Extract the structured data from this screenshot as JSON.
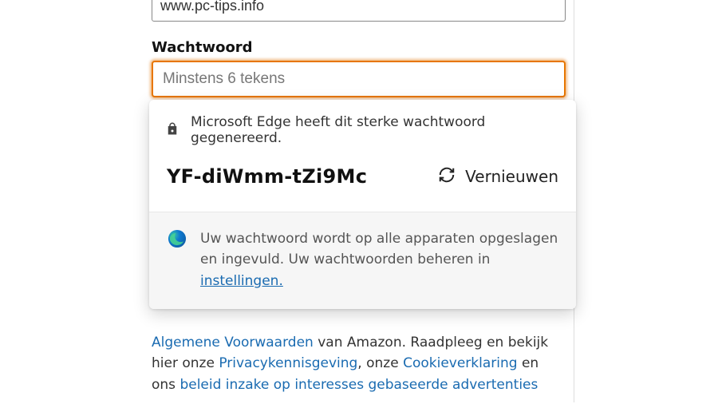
{
  "form": {
    "topFieldValue": "www.pc-tips.info",
    "passwordLabel": "Wachtwoord",
    "passwordPlaceholder": "Minstens 6 tekens"
  },
  "popup": {
    "headerText": "Microsoft Edge heeft dit sterke wachtwoord gegenereerd.",
    "generatedPassword": "YF-diWmm-tZi9Mc",
    "refreshLabel": "Vernieuwen",
    "footerText": "Uw wachtwoord wordt op alle apparaten opgeslagen en ingevuld. Uw wachtwoorden beheren in ",
    "settingsLink": "instellingen."
  },
  "terms": {
    "link1": "Algemene Voorwaarden",
    "text1": " van Amazon. Raadpleeg en bekijk hier onze ",
    "link2": "Privacykennisgeving",
    "text2": ", onze ",
    "link3": "Cookieverklaring",
    "text3": " en ons ",
    "link4": "beleid inzake op interesses gebaseerde advertenties"
  }
}
